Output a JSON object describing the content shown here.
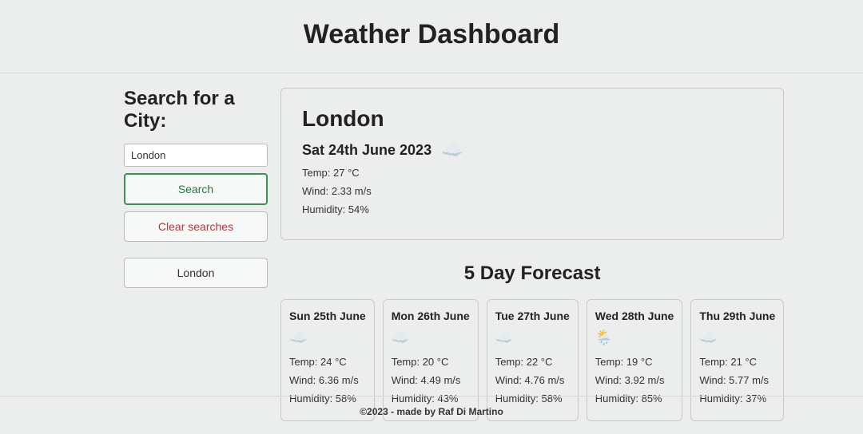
{
  "header": {
    "title": "Weather Dashboard"
  },
  "sidebar": {
    "search_label": "Search for a City:",
    "search_input_value": "London",
    "search_button": "Search",
    "clear_button": "Clear searches",
    "history": [
      "London"
    ]
  },
  "current": {
    "city": "London",
    "date": "Sat 24th June 2023",
    "icon": "cloud-icon",
    "icon_glyph": "☁️",
    "temp": "Temp: 27 °C",
    "wind": "Wind: 2.33 m/s",
    "humidity": "Humidity: 54%"
  },
  "forecast_title": "5 Day Forecast",
  "forecast": [
    {
      "date": "Sun 25th June",
      "icon": "cloud-icon",
      "icon_glyph": "☁️",
      "temp": "Temp: 24 °C",
      "wind": "Wind: 6.36 m/s",
      "humidity": "Humidity: 58%"
    },
    {
      "date": "Mon 26th June",
      "icon": "cloud-icon",
      "icon_glyph": "☁️",
      "temp": "Temp: 20 °C",
      "wind": "Wind: 4.49 m/s",
      "humidity": "Humidity: 43%"
    },
    {
      "date": "Tue 27th June",
      "icon": "cloud-icon",
      "icon_glyph": "☁️",
      "temp": "Temp: 22 °C",
      "wind": "Wind: 4.76 m/s",
      "humidity": "Humidity: 58%"
    },
    {
      "date": "Wed 28th June",
      "icon": "rain-icon",
      "icon_glyph": "🌦️",
      "temp": "Temp: 19 °C",
      "wind": "Wind: 3.92 m/s",
      "humidity": "Humidity: 85%"
    },
    {
      "date": "Thu 29th June",
      "icon": "cloud-icon",
      "icon_glyph": "☁️",
      "temp": "Temp: 21 °C",
      "wind": "Wind: 5.77 m/s",
      "humidity": "Humidity: 37%"
    }
  ],
  "footer": {
    "text": "©2023 - made by Raf Di Martino"
  }
}
